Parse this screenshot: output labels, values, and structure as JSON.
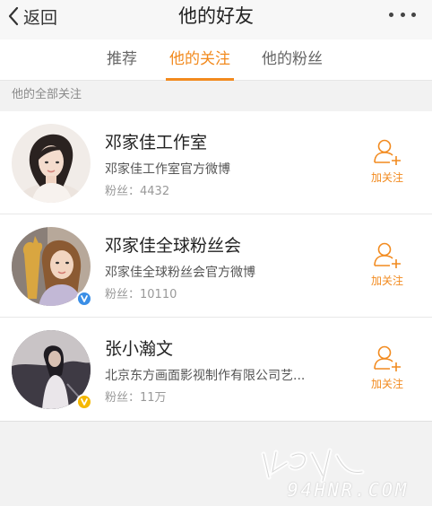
{
  "nav": {
    "back_label": "返回",
    "title": "他的好友"
  },
  "tabs": [
    {
      "label": "推荐",
      "active": false
    },
    {
      "label": "他的关注",
      "active": true
    },
    {
      "label": "他的粉丝",
      "active": false
    }
  ],
  "section_label": "他的全部关注",
  "accent_color": "#f28a1e",
  "users": [
    {
      "name": "邓家佳工作室",
      "description": "邓家佳工作室官方微博",
      "fans": "粉丝：4432",
      "verified": false,
      "follow_label": "加关注"
    },
    {
      "name": "邓家佳全球粉丝会",
      "description": "邓家佳全球粉丝会官方微博",
      "fans": "粉丝：10110",
      "verified": true,
      "badge_color": "#3a8ee6",
      "follow_label": "加关注"
    },
    {
      "name": "张小瀚文",
      "description": "北京东方画面影视制作有限公司艺...",
      "fans": "粉丝：11万",
      "verified": true,
      "badge_color": "#f5b800",
      "follow_label": "加关注"
    }
  ],
  "watermark": "94HNR.COM"
}
